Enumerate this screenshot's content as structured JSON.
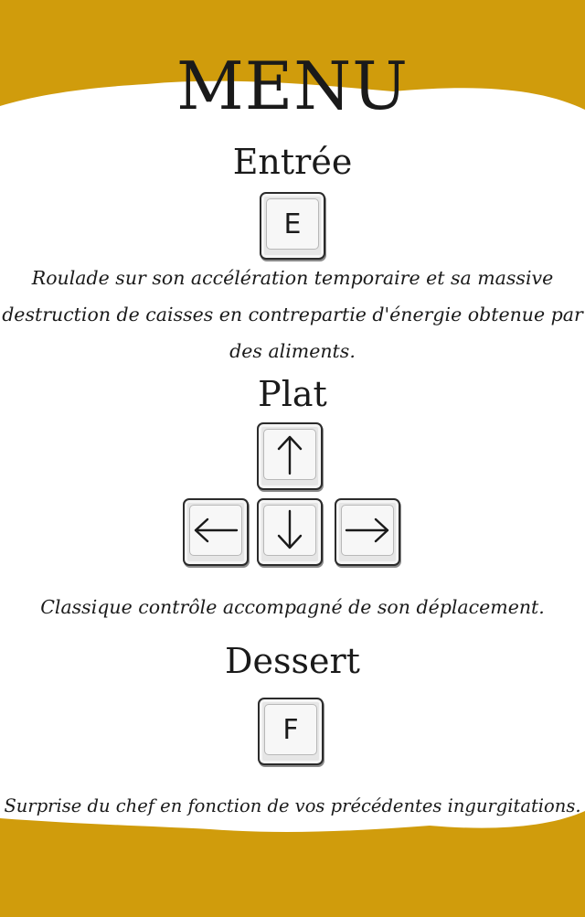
{
  "colors": {
    "band": "#d09c0c",
    "background": "#ffffff",
    "text": "#1a1a1a"
  },
  "menu": {
    "title": "MENU"
  },
  "sections": [
    {
      "heading": "Entrée",
      "keys": [
        "E"
      ],
      "description_lines": [
        "Roulade sur son accélération temporaire et sa massive",
        "destruction de caisses en contrepartie d'énergie obtenue par",
        "des aliments."
      ]
    },
    {
      "heading": "Plat",
      "keys": [
        "arrow-up-icon",
        "arrow-left-icon",
        "arrow-down-icon",
        "arrow-right-icon"
      ],
      "description_lines": [
        "Classique contrôle accompagné de son déplacement."
      ]
    },
    {
      "heading": "Dessert",
      "keys": [
        "F"
      ],
      "description_lines": [
        "Surprise du chef en fonction de vos précédentes ingurgitations."
      ]
    }
  ]
}
